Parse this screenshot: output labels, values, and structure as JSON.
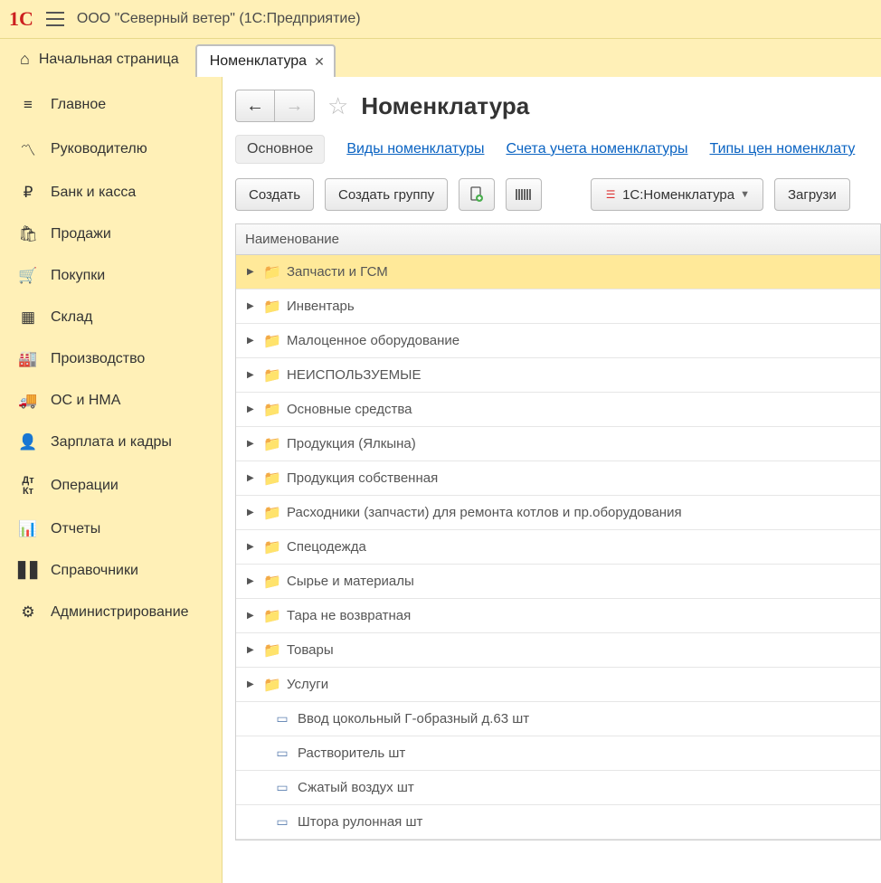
{
  "titlebar": {
    "text": "ООО \"Северный ветер\"  (1С:Предприятие)"
  },
  "tabs": {
    "home": "Начальная страница",
    "active": "Номенклатура"
  },
  "sidebar": [
    "Главное",
    "Руководителю",
    "Банк и касса",
    "Продажи",
    "Покупки",
    "Склад",
    "Производство",
    "ОС и НМА",
    "Зарплата и кадры",
    "Операции",
    "Отчеты",
    "Справочники",
    "Администрирование"
  ],
  "page": {
    "title": "Номенклатура"
  },
  "subnav": {
    "active": "Основное",
    "links": [
      "Виды номенклатуры",
      "Счета учета номенклатуры",
      "Типы цен номенклату"
    ]
  },
  "toolbar": {
    "create": "Создать",
    "create_group": "Создать группу",
    "dropdown": "1С:Номенклатура",
    "load": "Загрузи"
  },
  "table": {
    "header": "Наименование",
    "rows": [
      {
        "kind": "folder",
        "label": "Запчасти и ГСМ",
        "selected": true
      },
      {
        "kind": "folder",
        "label": "Инвентарь"
      },
      {
        "kind": "folder",
        "label": "Малоценное оборудование"
      },
      {
        "kind": "folder",
        "label": "НЕИСПОЛЬЗУЕМЫЕ"
      },
      {
        "kind": "folder",
        "label": "Основные средства"
      },
      {
        "kind": "folder",
        "label": "Продукция (Ялкына)"
      },
      {
        "kind": "folder",
        "label": "Продукция собственная"
      },
      {
        "kind": "folder",
        "label": "Расходники (запчасти) для ремонта котлов и пр.оборудования"
      },
      {
        "kind": "folder",
        "label": "Спецодежда"
      },
      {
        "kind": "folder",
        "label": "Сырье и материалы"
      },
      {
        "kind": "folder",
        "label": "Тара не возвратная"
      },
      {
        "kind": "folder",
        "label": "Товары"
      },
      {
        "kind": "folder",
        "label": "Услуги"
      },
      {
        "kind": "item",
        "label": "Ввод цокольный Г-образный д.63 шт"
      },
      {
        "kind": "item",
        "label": "Растворитель шт"
      },
      {
        "kind": "item",
        "label": "Сжатый воздух шт"
      },
      {
        "kind": "item",
        "label": "Штора рулонная шт"
      }
    ]
  }
}
